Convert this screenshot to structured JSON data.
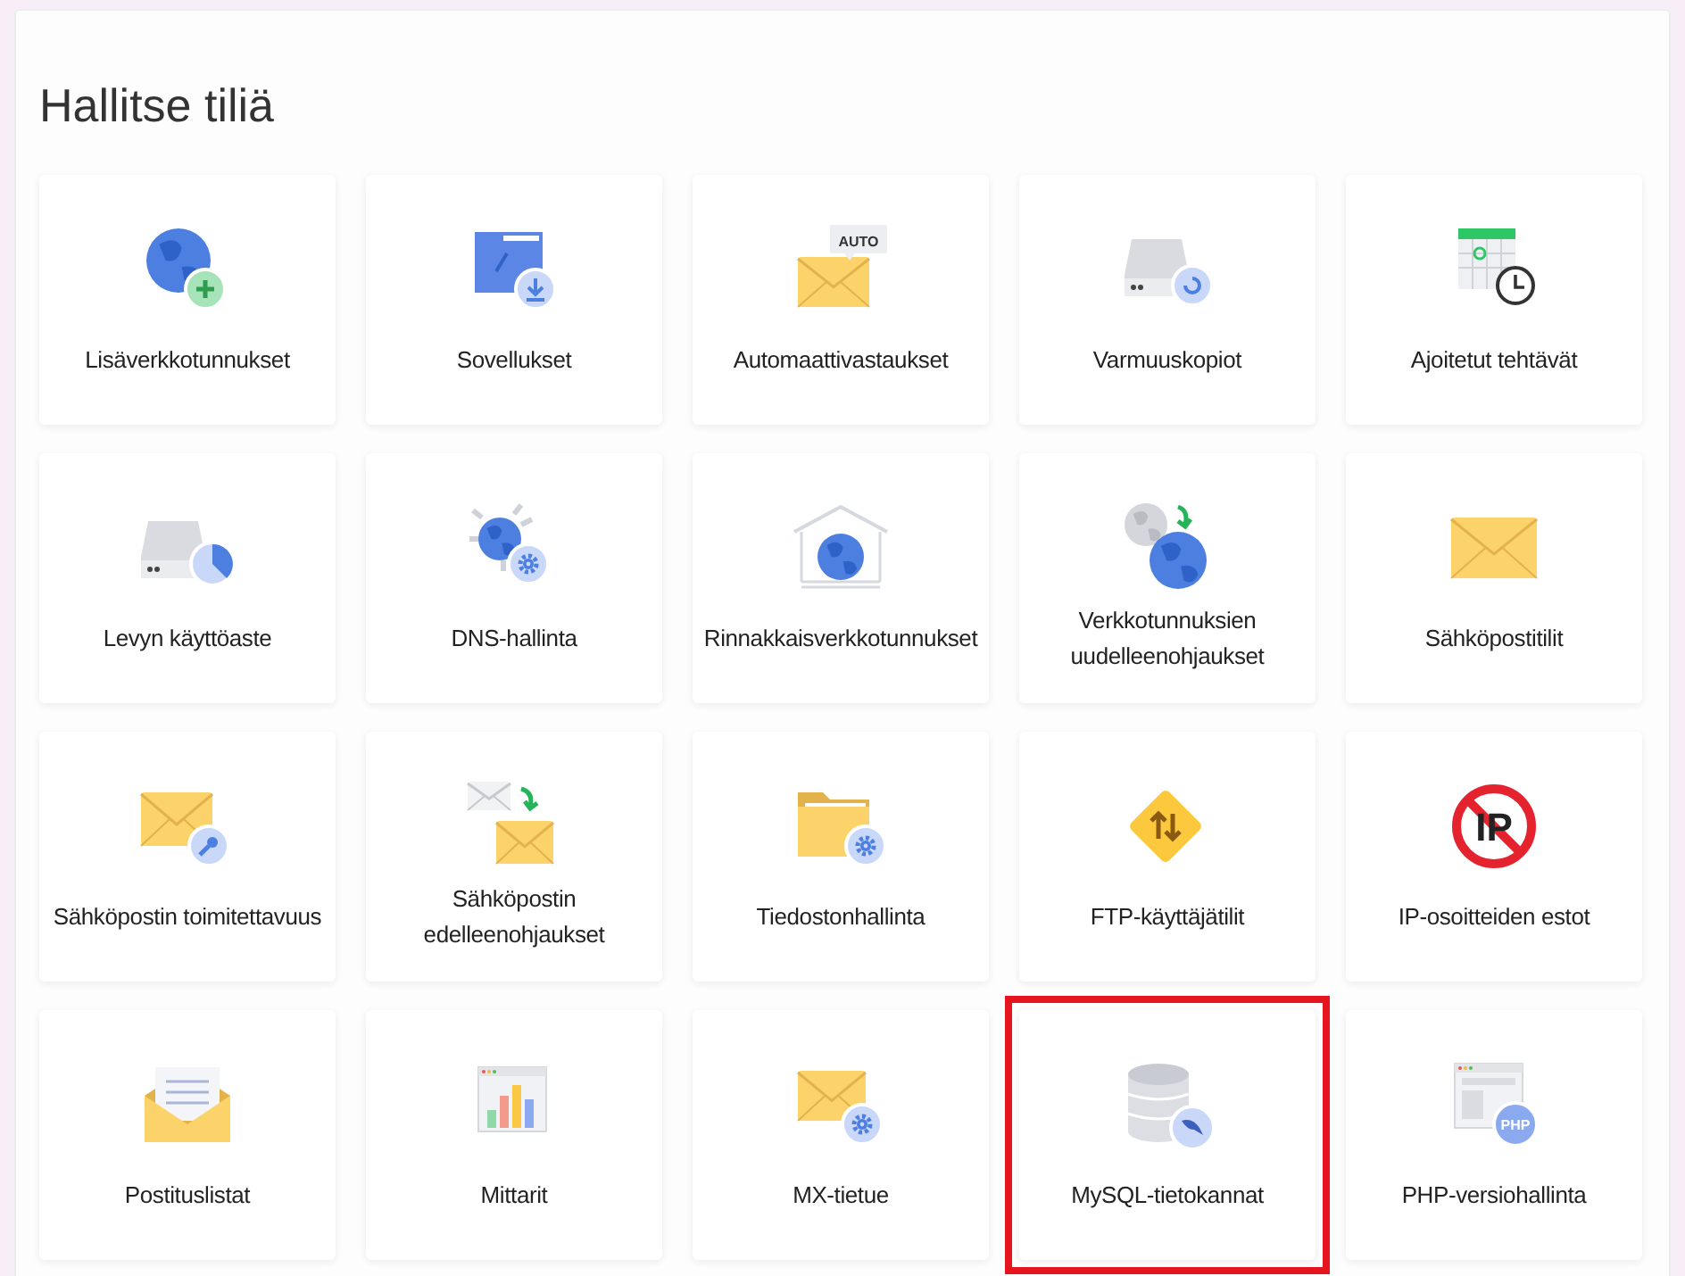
{
  "title": "Hallitse tiliä",
  "tiles": [
    {
      "label": "Lisäverkkotunnukset",
      "kind": "globe-plus",
      "highlighted": false
    },
    {
      "label": "Sovellukset",
      "kind": "folder-download",
      "highlighted": false
    },
    {
      "label": "Automaattivastaukset",
      "kind": "mail-auto",
      "icon_text": "AUTO",
      "highlighted": false
    },
    {
      "label": "Varmuuskopiot",
      "kind": "drive-restore",
      "highlighted": false
    },
    {
      "label": "Ajoitetut tehtävät",
      "kind": "calendar-clock",
      "highlighted": false
    },
    {
      "label": "Levyn käyttöaste",
      "kind": "drive-pie",
      "highlighted": false
    },
    {
      "label": "DNS-hallinta",
      "kind": "globe-gear",
      "highlighted": false
    },
    {
      "label": "Rinnakkaisverkkotunnukset",
      "kind": "house-globe",
      "highlighted": false
    },
    {
      "label": "Verkkotunnuksien uudelleenohjaukset",
      "kind": "globes-arrow",
      "highlighted": false
    },
    {
      "label": "Sähköpostitilit",
      "kind": "mail",
      "highlighted": false
    },
    {
      "label": "Sähköpostin toimitettavuus",
      "kind": "mail-key",
      "highlighted": false
    },
    {
      "label": "Sähköpostin edelleenohjaukset",
      "kind": "mail-forward",
      "highlighted": false
    },
    {
      "label": "Tiedostonhallinta",
      "kind": "folder-gear",
      "highlighted": false
    },
    {
      "label": "FTP-käyttäjätilit",
      "kind": "ftp-diamond",
      "highlighted": false
    },
    {
      "label": "IP-osoitteiden estot",
      "kind": "ip-blocked",
      "icon_text": "IP",
      "highlighted": false
    },
    {
      "label": "Postituslistat",
      "kind": "mail-letter",
      "highlighted": false
    },
    {
      "label": "Mittarit",
      "kind": "bar-chart",
      "highlighted": false
    },
    {
      "label": "MX-tietue",
      "kind": "mail-gear",
      "highlighted": false
    },
    {
      "label": "MySQL-tietokannat",
      "kind": "database",
      "highlighted": true
    },
    {
      "label": "PHP-versiohallinta",
      "kind": "browser-php",
      "icon_text": "PHP",
      "highlighted": false
    }
  ]
}
